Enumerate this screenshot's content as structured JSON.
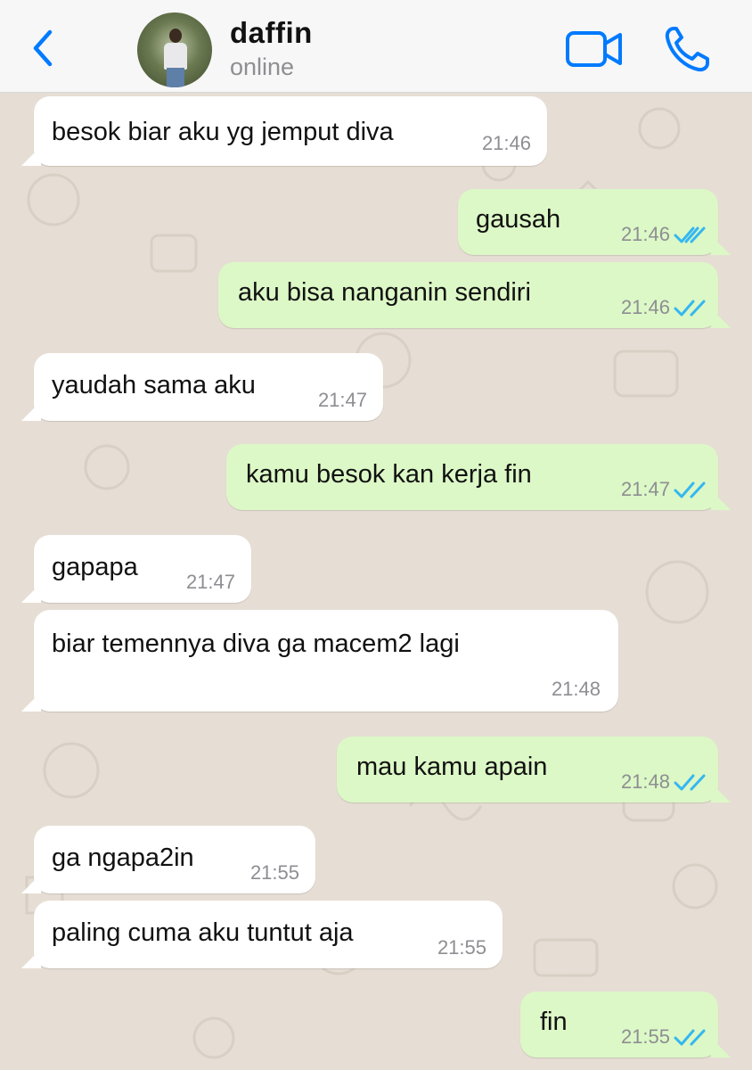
{
  "header": {
    "contact_name": "daffin",
    "contact_status": "online",
    "back_icon": "chevron-left-icon",
    "video_icon": "video-camera-icon",
    "call_icon": "phone-icon",
    "accent_color": "#007aff"
  },
  "colors": {
    "incoming_bubble": "#ffffff",
    "outgoing_bubble": "#dcf8c6",
    "read_ticks": "#34b7f1",
    "chat_background": "#e6ded4"
  },
  "messages": [
    {
      "direction": "in",
      "text": "besok biar aku yg jemput diva",
      "time": "21:46"
    },
    {
      "direction": "out",
      "text": "gausah",
      "time": "21:46",
      "status": "read"
    },
    {
      "direction": "out",
      "text": "aku bisa nanganin sendiri",
      "time": "21:46",
      "status": "read"
    },
    {
      "direction": "in",
      "text": "yaudah sama aku",
      "time": "21:47"
    },
    {
      "direction": "out",
      "text": "kamu besok kan kerja fin",
      "time": "21:47",
      "status": "read"
    },
    {
      "direction": "in",
      "text": "gapapa",
      "time": "21:47"
    },
    {
      "direction": "in",
      "text": "biar temennya diva ga macem2 lagi",
      "time": "21:48"
    },
    {
      "direction": "out",
      "text": "mau kamu apain",
      "time": "21:48",
      "status": "read"
    },
    {
      "direction": "in",
      "text": "ga ngapa2in",
      "time": "21:55"
    },
    {
      "direction": "in",
      "text": "paling cuma aku tuntut aja",
      "time": "21:55"
    },
    {
      "direction": "out",
      "text": "fin",
      "time": "21:55",
      "status": "read"
    }
  ]
}
